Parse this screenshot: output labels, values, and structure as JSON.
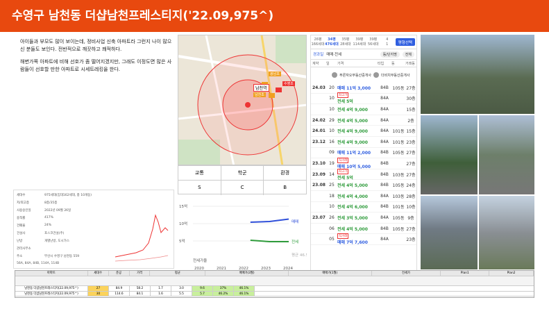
{
  "title": "수영구 남천동 더샵남천프레스티지('22.09,975^)",
  "description": [
    "아이들과 부모도 많이 보이는데, 정비사업 신축 아파트라 그런지 나이 많으신 분들도 보인다. 전반적으로 깨끗하고 쾌적하다.",
    "해변가쪽 아파트에 비해 선호가 좀 떨어지겠지만, 그래도 이정도면 많은 사람들이 선호할 만한 아파트로 시세트레킹을 한다."
  ],
  "grade": {
    "headers": [
      "교통",
      "학군",
      "환경"
    ],
    "values": [
      "S",
      "C",
      "B"
    ]
  },
  "map": {
    "labels": [
      "남천역",
      "광남초",
      "수영초",
      "남천초",
      "7.8",
      "8.6",
      "6.3"
    ]
  },
  "deal": {
    "tabs": [
      {
        "top": "26평",
        "bot": "166세대"
      },
      {
        "top": "34평",
        "bot": "476세대"
      },
      {
        "top": "35평",
        "bot": "28세대"
      },
      {
        "top": "39평",
        "bot": "114세대"
      },
      {
        "top": "39평",
        "bot": "56세대"
      },
      {
        "top": "4",
        "bot": "1"
      }
    ],
    "btn": "평형선택",
    "tab2": "경과일",
    "toggle": "매매·전세",
    "chip1": "동/단지명",
    "chip2": "전체",
    "cols": [
      "계약",
      "일",
      "층",
      "가격",
      "",
      "동",
      "타입",
      "거래동"
    ],
    "agent1": "푸른자오부동산중개사",
    "agent2": "더비치부동산중개사",
    "rows": [
      {
        "d": "24.03",
        "f": "20",
        "p": "매매 11억 3,000",
        "a": "84B",
        "n": "105동",
        "t": "27층"
      },
      {
        "d": "",
        "f": "10",
        "p": "전세 5억",
        "a": "84A",
        "n": "",
        "t": "30층",
        "tag": "최고가"
      },
      {
        "d": "",
        "f": "10",
        "p": "전세 4억 9,000",
        "a": "84A",
        "n": "",
        "t": "15층"
      },
      {
        "d": "24.02",
        "f": "29",
        "p": "전세 4억 5,000",
        "a": "84A",
        "n": "",
        "t": "2층"
      },
      {
        "d": "24.01",
        "f": "10",
        "p": "전세 4억 9,000",
        "a": "84A",
        "n": "101동",
        "t": "15층"
      },
      {
        "d": "23.12",
        "f": "16",
        "p": "전세 4억 9,000",
        "a": "84A",
        "n": "101동",
        "t": "23층"
      },
      {
        "d": "",
        "f": "09",
        "p": "매매 11억 2,000",
        "a": "84B",
        "n": "105동",
        "t": "27층"
      },
      {
        "d": "23.10",
        "f": "19",
        "p": "매매 10억 5,000",
        "a": "84B",
        "n": "",
        "t": "27층",
        "tag": "직거래"
      },
      {
        "d": "23.09",
        "f": "14",
        "p": "전세 5억",
        "a": "84B",
        "n": "103동",
        "t": "27층",
        "tag": "최고가"
      },
      {
        "d": "23.08",
        "f": "25",
        "p": "전세 4억 5,000",
        "a": "84B",
        "n": "105동",
        "t": "24층"
      },
      {
        "d": "",
        "f": "18",
        "p": "전세 4억 4,000",
        "a": "84A",
        "n": "103동",
        "t": "28층"
      },
      {
        "d": "",
        "f": "10",
        "p": "전세 4억 6,000",
        "a": "84B",
        "n": "101동",
        "t": "10층"
      },
      {
        "d": "23.07",
        "f": "26",
        "p": "전세 3억 5,000",
        "a": "84A",
        "n": "105동",
        "t": "9층"
      },
      {
        "d": "",
        "f": "06",
        "p": "전세 4억 5,000",
        "a": "84B",
        "n": "105동",
        "t": "27층"
      },
      {
        "d": "",
        "f": "05",
        "p": "매매 7억 7,600",
        "a": "84A",
        "n": "",
        "t": "23층",
        "tag": "직거래"
      }
    ]
  },
  "info": {
    "left": [
      [
        "세대수",
        "975세대(임대162세대, 총 10개동)"
      ],
      [
        "저/최고층",
        "8층/35층"
      ],
      [
        "사용승인일",
        "2022년 09월 26일"
      ],
      [
        "용적률",
        "417%"
      ],
      [
        "건폐율",
        "24%"
      ],
      [
        "건설사",
        "포스코건설(주)"
      ],
      [
        "난방",
        "개별난방, 도시가스"
      ],
      [
        "관리사무소",
        ""
      ],
      [
        "주소",
        "부산시 수영구 남천동 559"
      ]
    ],
    "sizes": "56A, 84A, 84B, 114A, 114B"
  },
  "chart_data": {
    "type": "line",
    "x": [
      "2020",
      "2021",
      "2022",
      "2023",
      "2024"
    ],
    "ylabel": "",
    "ytick_labels": [
      "15억",
      "10억",
      "5억"
    ],
    "series": [
      {
        "name": "매매",
        "values": [
          null,
          null,
          null,
          10.4,
          10.6,
          11.3
        ]
      },
      {
        "name": "전세",
        "values": [
          null,
          null,
          null,
          5.2,
          4.8,
          4.8
        ]
      },
      {
        "name": "평균",
        "values": [
          null,
          null,
          null,
          null,
          null,
          null
        ]
      }
    ],
    "right_labels": [
      "매매",
      "전세",
      "평균 46.5%"
    ],
    "bottom": [
      "전세가율"
    ]
  },
  "table": {
    "head1": [
      "아파트",
      "세대수",
      "준공",
      "가격",
      "평균",
      "매매가(3월)",
      "매매가(1월)",
      "전세가",
      "Plan1",
      "Plan2"
    ],
    "rows": [
      [
        "남천동 더샵남천프레스티지(22.09,975^)",
        "27",
        "84.9",
        "58.2",
        "1.7",
        "3.0",
        "9.6",
        "37%",
        "46.1%"
      ],
      [
        "남천동 더샵남천프레스티지(22.09,975^)",
        "30",
        "114.6",
        "84.1",
        "1.6",
        "5.5",
        "5.7",
        "46.2%",
        "46.1%"
      ]
    ]
  },
  "colors": {
    "accent": "#e8490f",
    "blue": "#2f5ee0",
    "green": "#2e9b3b"
  }
}
